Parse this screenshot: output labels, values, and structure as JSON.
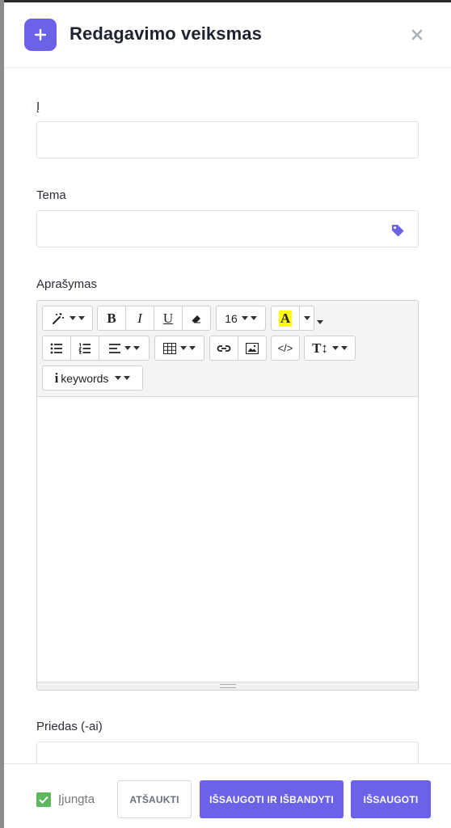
{
  "modal": {
    "title": "Redagavimo veiksmas",
    "accent_color": "#6c62e8"
  },
  "fields": {
    "to_label": "Į",
    "to_value": "",
    "subject_label": "Tema",
    "subject_value": "",
    "description_label": "Aprašymas",
    "attachments_label": "Priedas (-ai)"
  },
  "editor": {
    "font_size": "16",
    "keywords_label": "keywords",
    "code_label": "</>",
    "text_height_label": "T↕",
    "highlight_letter": "A",
    "bold_label": "B",
    "italic_label": "I",
    "underline_label": "U",
    "content": ""
  },
  "footer": {
    "enabled_label": "Įjungta",
    "enabled_checked": true,
    "cancel_label": "ATŠAUKTI",
    "save_test_label": "IŠSAUGOTI IR IŠBANDYTI",
    "save_label": "IŠSAUGOTI"
  }
}
